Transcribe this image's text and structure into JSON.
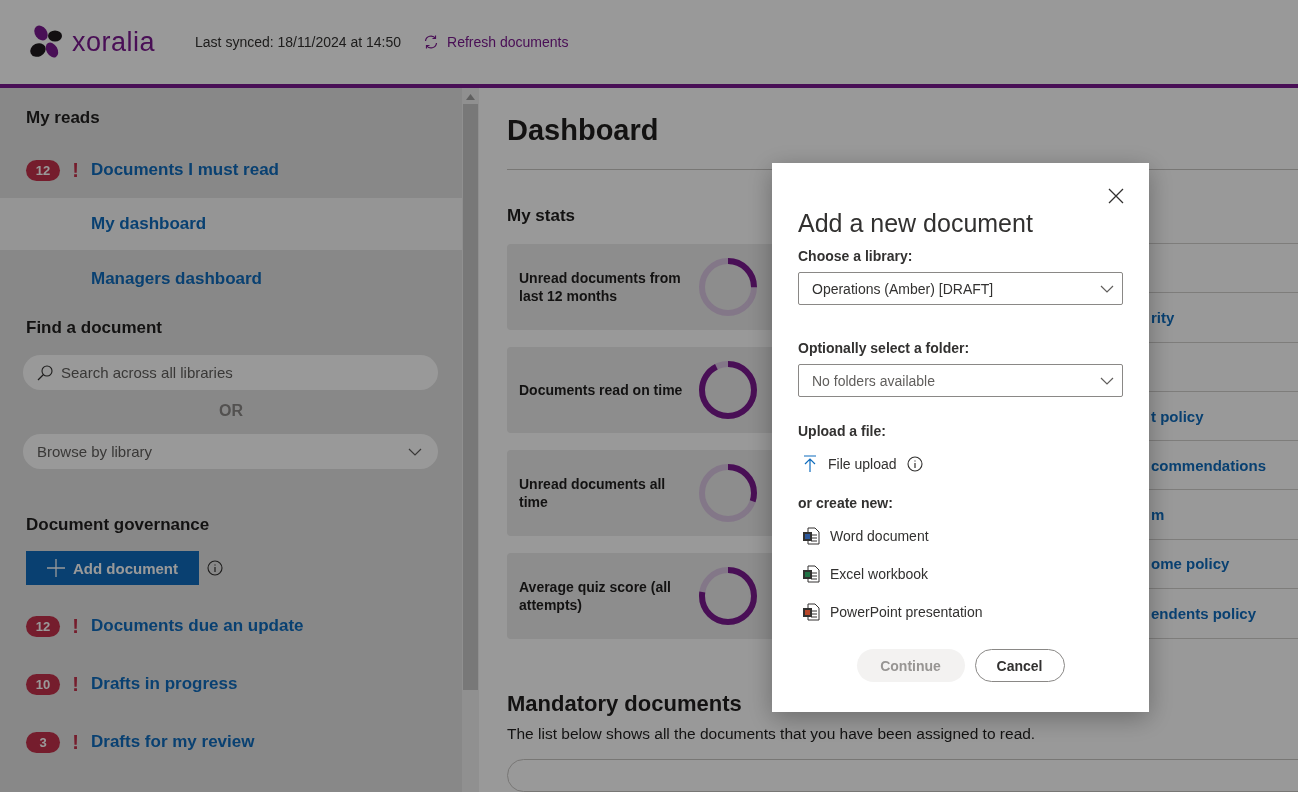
{
  "header": {
    "logo_text": "xoralia",
    "sync_text": "Last synced: 18/11/2024 at 14:50",
    "refresh_label": "Refresh documents"
  },
  "sidebar": {
    "my_reads": {
      "title": "My reads",
      "items": [
        {
          "kind": "alert",
          "badge": "12",
          "alert_mark": "!",
          "label": "Documents I must read",
          "selected": false
        },
        {
          "kind": "link",
          "label": "My dashboard",
          "selected": true
        },
        {
          "kind": "link",
          "label": "Managers dashboard",
          "selected": false
        }
      ]
    },
    "find": {
      "title": "Find a document",
      "search_placeholder": "Search across all libraries",
      "or_text": "OR",
      "browse_label": "Browse by library"
    },
    "governance": {
      "title": "Document governance",
      "add_button": "Add document",
      "items": [
        {
          "badge": "12",
          "alert_mark": "!",
          "label": "Documents due an update"
        },
        {
          "badge": "10",
          "alert_mark": "!",
          "label": "Drafts in progress"
        },
        {
          "badge": "3",
          "alert_mark": "!",
          "label": "Drafts for my review"
        }
      ]
    }
  },
  "main": {
    "title": "Dashboard",
    "stats_title": "My stats",
    "stats": [
      {
        "label": "Unread documents from last 12 months",
        "level": 0.25
      },
      {
        "label": "Documents read on time",
        "level": 0.92
      },
      {
        "label": "Unread documents all time",
        "level": 0.3
      },
      {
        "label": "Average quiz score (all attempts)",
        "level": 0.77
      }
    ],
    "list_rows": [
      {
        "kind": "blank"
      },
      {
        "kind": "link",
        "label": "rity"
      },
      {
        "kind": "blank"
      },
      {
        "kind": "link",
        "label": "t policy"
      },
      {
        "kind": "link",
        "label": "commendations"
      },
      {
        "kind": "link",
        "label": "m"
      },
      {
        "kind": "link",
        "label": "ome policy"
      },
      {
        "kind": "link",
        "label": "endents policy"
      }
    ],
    "mandatory": {
      "title": "Mandatory documents",
      "description": "The list below shows all the documents that you have been assigned to read."
    }
  },
  "modal": {
    "title": "Add a new document",
    "library_label": "Choose a library:",
    "library_value": "Operations (Amber) [DRAFT]",
    "folder_label": "Optionally select a folder:",
    "folder_placeholder": "No folders available",
    "upload_label": "Upload a file:",
    "upload_item": "File upload",
    "create_label": "or create new:",
    "create_items": [
      {
        "kind": "word",
        "label": "Word document"
      },
      {
        "kind": "excel",
        "label": "Excel workbook"
      },
      {
        "kind": "powerpoint",
        "label": "PowerPoint presentation"
      }
    ],
    "continue": {
      "label": "Continue",
      "disabled": true
    },
    "cancel": "Cancel"
  }
}
